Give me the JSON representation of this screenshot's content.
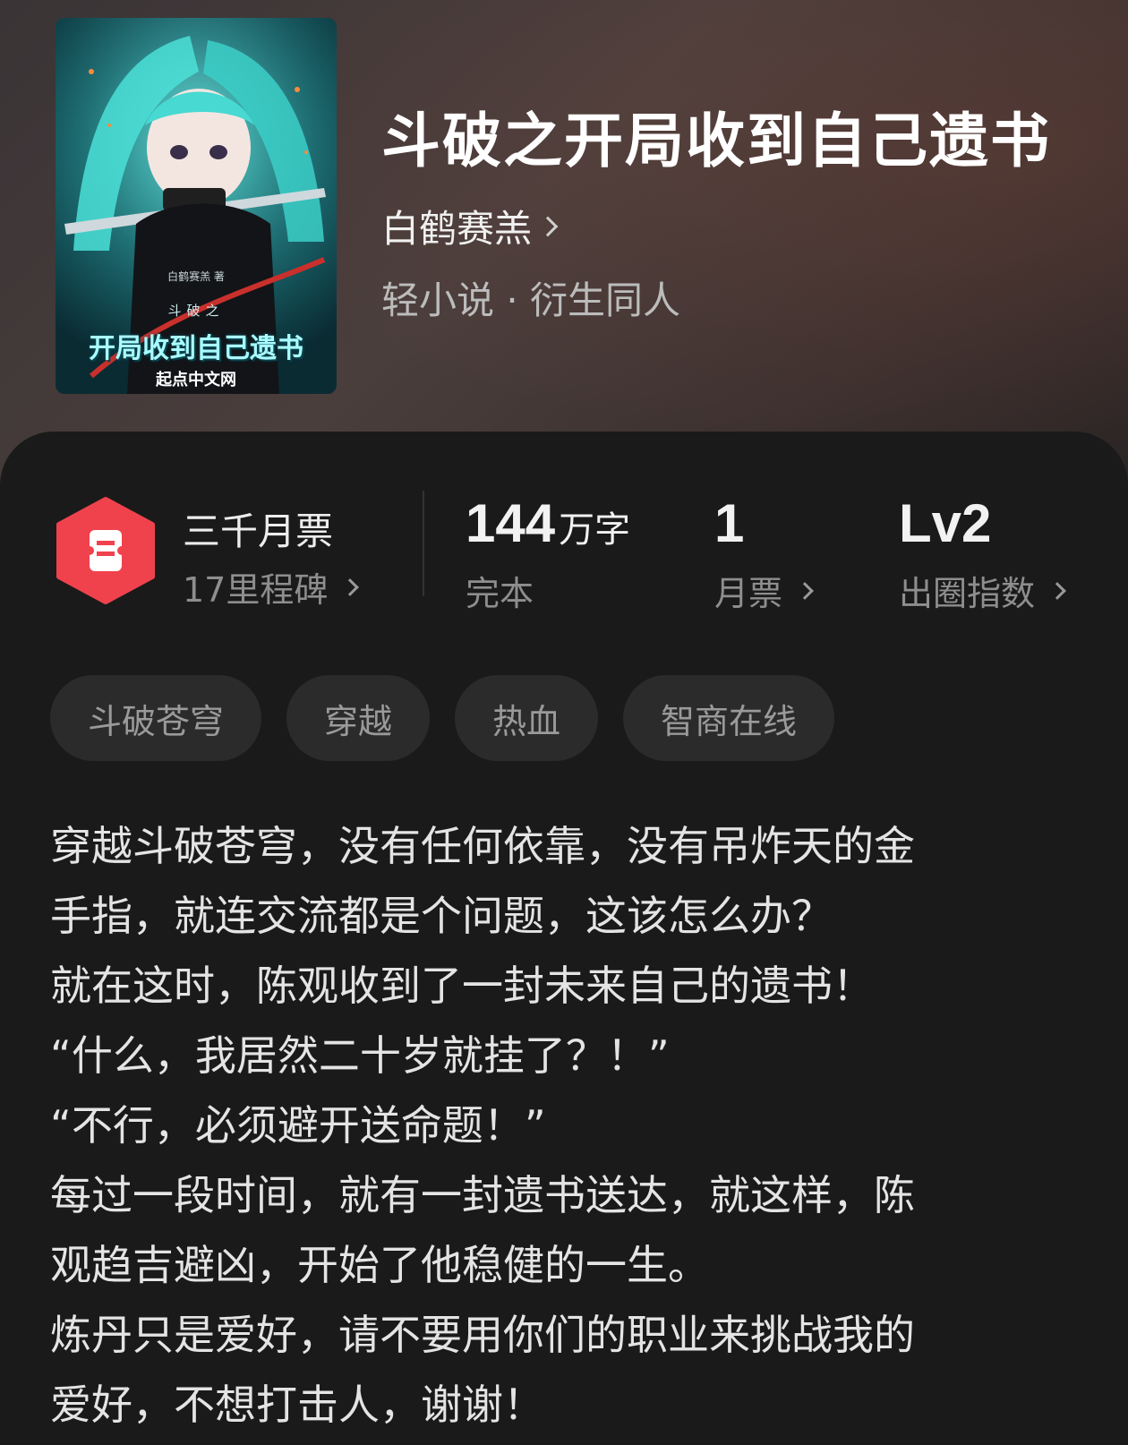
{
  "book": {
    "title": "斗破之开局收到自己遗书",
    "author": "白鹤赛羔",
    "genre": "轻小说 · 衍生同人"
  },
  "cover": {
    "author_text": "白鹤赛羔 著",
    "pre_title": "斗破之",
    "title": "开局收到自己遗书",
    "publisher": "起点中文网"
  },
  "stats": {
    "badge_title": "三千月票",
    "badge_sub": "17里程碑",
    "word_count": "144",
    "word_unit": "万字",
    "status": "完本",
    "monthly_votes": "1",
    "monthly_votes_label": "月票",
    "popularity_level": "Lv2",
    "popularity_label": "出圈指数"
  },
  "tags": [
    "斗破苍穹",
    "穿越",
    "热血",
    "智商在线"
  ],
  "synopsis": [
    "穿越斗破苍穹，没有任何依靠，没有吊炸天的金",
    "手指，就连交流都是个问题，这该怎么办？",
    "就在这时，陈观收到了一封未来自己的遗书！",
    "“什么，我居然二十岁就挂了？！”",
    "“不行，必须避开送命题！”",
    "每过一段时间，就有一封遗书送达，就这样，陈",
    "观趋吉避凶，开始了他稳健的一生。",
    "炼丹只是爱好，请不要用你们的职业来挑战我的",
    "爱好，不想打击人，谢谢！"
  ],
  "colors": {
    "badge_red": "#f0424d",
    "background": "#1a1a1a",
    "tag_bg": "#2b2b2b"
  }
}
